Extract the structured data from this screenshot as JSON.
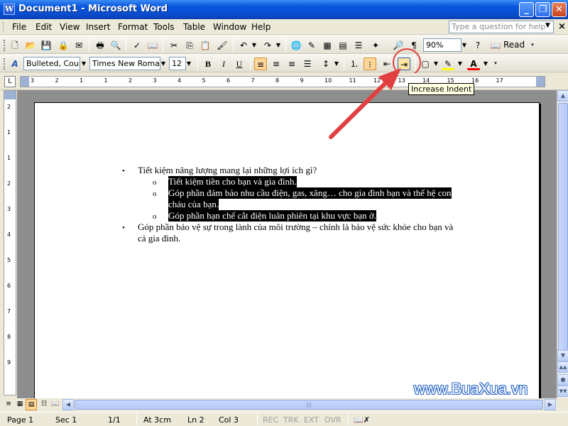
{
  "window": {
    "title": "Document1 - Microsoft Word"
  },
  "menu": {
    "items": [
      "File",
      "Edit",
      "View",
      "Insert",
      "Format",
      "Tools",
      "Table",
      "Window",
      "Help"
    ],
    "ask_placeholder": "Type a question for help"
  },
  "toolbar": {
    "zoom": "90%",
    "read_label": "Read",
    "style": "Bulleted, Couri",
    "font": "Times New Roman",
    "size": "12"
  },
  "tooltip": "Increase Indent",
  "ruler": {
    "h_labels": [
      "3",
      "2",
      "1",
      "1",
      "2",
      "3",
      "4",
      "5",
      "6",
      "7",
      "8",
      "9",
      "10",
      "11",
      "12",
      "13",
      "14",
      "15",
      "16",
      "17"
    ],
    "v_labels": [
      "2",
      "1",
      "1",
      "2",
      "3",
      "4",
      "5",
      "6",
      "7",
      "8",
      "9"
    ]
  },
  "document": {
    "items": [
      {
        "level": 1,
        "bullet": "•",
        "lines": [
          "Tiết kiệm năng lượng mang lại những lợi ích gì?"
        ],
        "selected": false
      },
      {
        "level": 2,
        "bullet": "o",
        "lines": [
          "Tiết kiệm tiền cho bạn và gia đình."
        ],
        "selected": true
      },
      {
        "level": 2,
        "bullet": "o",
        "lines": [
          "Góp phần đảm bảo nhu cầu điện, gas, xăng… cho gia đình bạn và thế hệ con",
          "cháu của bạn."
        ],
        "selected": true
      },
      {
        "level": 2,
        "bullet": "o",
        "lines": [
          "Góp phần hạn chế cắt điện luân phiên tại khu vực bạn ở."
        ],
        "selected": true
      },
      {
        "level": 1,
        "bullet": "•",
        "lines": [
          "Góp phần bảo vệ sự trong lành của môi trường – chính là bảo vệ sức khỏe cho bạn và",
          "cả gia đình."
        ],
        "selected": false
      }
    ]
  },
  "status": {
    "page": "Page 1",
    "sec": "Sec 1",
    "pages": "1/1",
    "at": "At 3cm",
    "ln": "Ln 2",
    "col": "Col 3",
    "rec": "REC",
    "trk": "TRK",
    "ext": "EXT",
    "ovr": "OVR"
  },
  "watermark": "www.BuaXua.vn",
  "colors": {
    "titlebar": "#0A4BCB",
    "selection": "#000000",
    "arrow": "#E04040",
    "highlight": "#FFD79A"
  }
}
